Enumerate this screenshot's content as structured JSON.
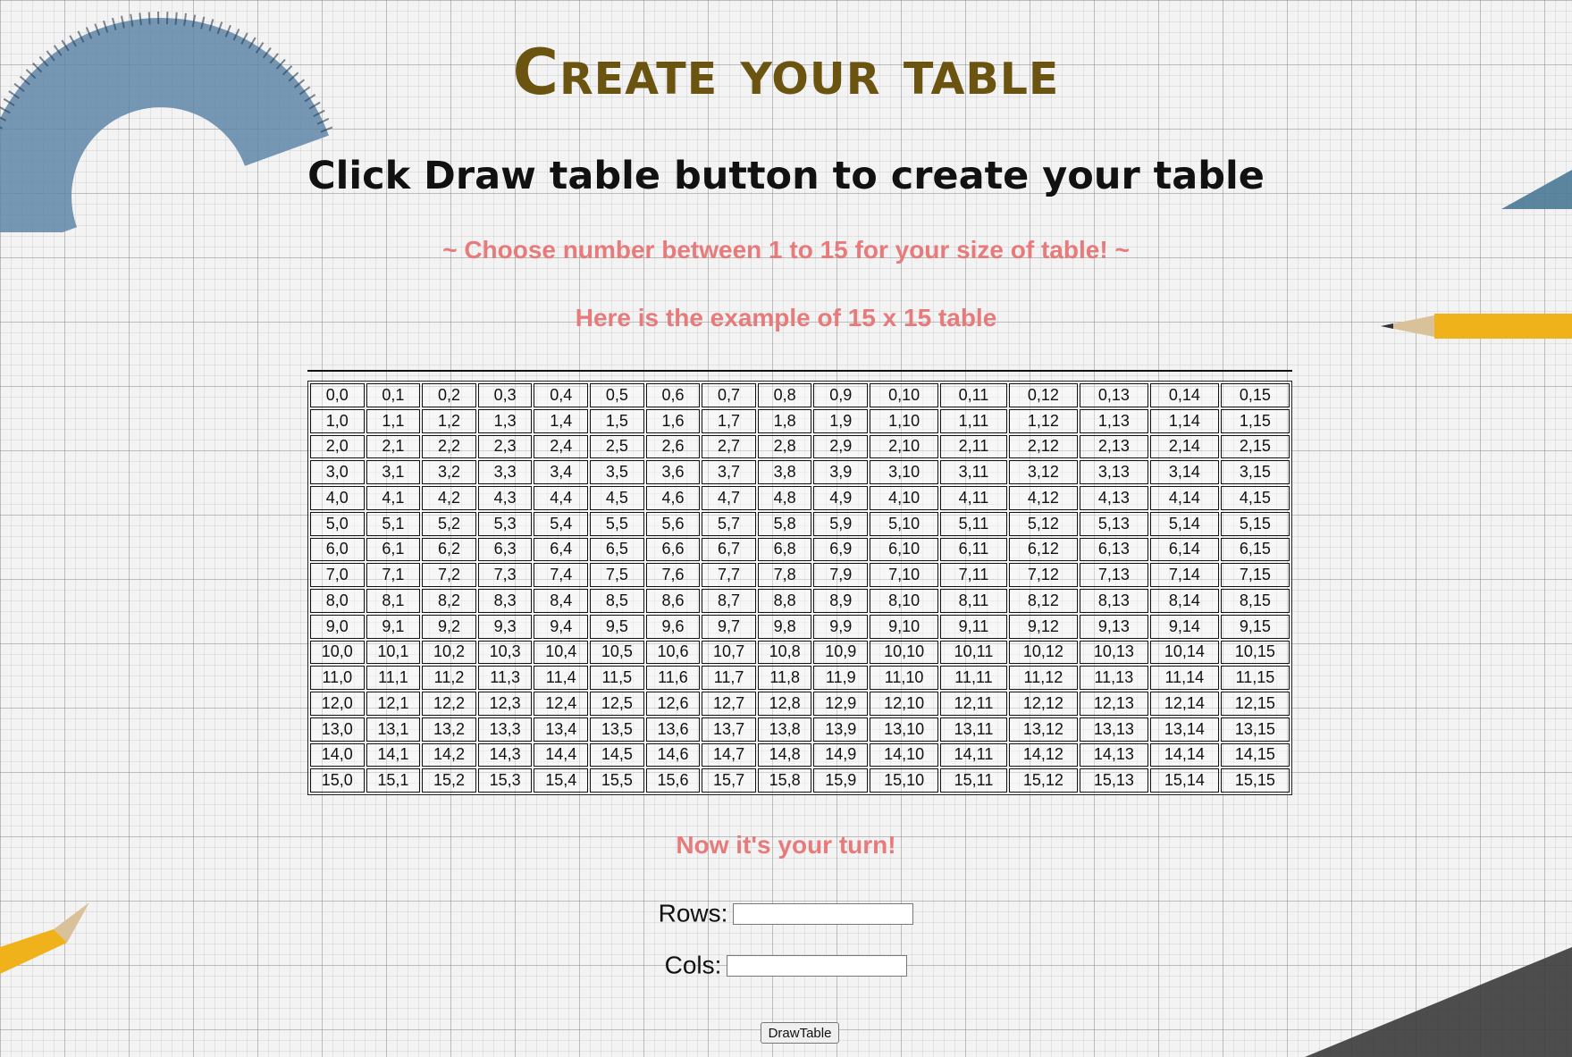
{
  "page": {
    "title": "Create your table",
    "subtitle": "Click Draw table button to create your table",
    "hint_range": "~ Choose number between 1 to 15 for your size of table! ~",
    "hint_example": "Here is the example of 15 x 15 table",
    "turn_text": "Now it's your turn!"
  },
  "example_table": {
    "rows": [
      [
        "0,0",
        "0,1",
        "0,2",
        "0,3",
        "0,4",
        "0,5",
        "0,6",
        "0,7",
        "0,8",
        "0,9",
        "0,10",
        "0,11",
        "0,12",
        "0,13",
        "0,14",
        "0,15"
      ],
      [
        "1,0",
        "1,1",
        "1,2",
        "1,3",
        "1,4",
        "1,5",
        "1,6",
        "1,7",
        "1,8",
        "1,9",
        "1,10",
        "1,11",
        "1,12",
        "1,13",
        "1,14",
        "1,15"
      ],
      [
        "2,0",
        "2,1",
        "2,2",
        "2,3",
        "2,4",
        "2,5",
        "2,6",
        "2,7",
        "2,8",
        "2,9",
        "2,10",
        "2,11",
        "2,12",
        "2,13",
        "2,14",
        "2,15"
      ],
      [
        "3,0",
        "3,1",
        "3,2",
        "3,3",
        "3,4",
        "3,5",
        "3,6",
        "3,7",
        "3,8",
        "3,9",
        "3,10",
        "3,11",
        "3,12",
        "3,13",
        "3,14",
        "3,15"
      ],
      [
        "4,0",
        "4,1",
        "4,2",
        "4,3",
        "4,4",
        "4,5",
        "4,6",
        "4,7",
        "4,8",
        "4,9",
        "4,10",
        "4,11",
        "4,12",
        "4,13",
        "4,14",
        "4,15"
      ],
      [
        "5,0",
        "5,1",
        "5,2",
        "5,3",
        "5,4",
        "5,5",
        "5,6",
        "5,7",
        "5,8",
        "5,9",
        "5,10",
        "5,11",
        "5,12",
        "5,13",
        "5,14",
        "5,15"
      ],
      [
        "6,0",
        "6,1",
        "6,2",
        "6,3",
        "6,4",
        "6,5",
        "6,6",
        "6,7",
        "6,8",
        "6,9",
        "6,10",
        "6,11",
        "6,12",
        "6,13",
        "6,14",
        "6,15"
      ],
      [
        "7,0",
        "7,1",
        "7,2",
        "7,3",
        "7,4",
        "7,5",
        "7,6",
        "7,7",
        "7,8",
        "7,9",
        "7,10",
        "7,11",
        "7,12",
        "7,13",
        "7,14",
        "7,15"
      ],
      [
        "8,0",
        "8,1",
        "8,2",
        "8,3",
        "8,4",
        "8,5",
        "8,6",
        "8,7",
        "8,8",
        "8,9",
        "8,10",
        "8,11",
        "8,12",
        "8,13",
        "8,14",
        "8,15"
      ],
      [
        "9,0",
        "9,1",
        "9,2",
        "9,3",
        "9,4",
        "9,5",
        "9,6",
        "9,7",
        "9,8",
        "9,9",
        "9,10",
        "9,11",
        "9,12",
        "9,13",
        "9,14",
        "9,15"
      ],
      [
        "10,0",
        "10,1",
        "10,2",
        "10,3",
        "10,4",
        "10,5",
        "10,6",
        "10,7",
        "10,8",
        "10,9",
        "10,10",
        "10,11",
        "10,12",
        "10,13",
        "10,14",
        "10,15"
      ],
      [
        "11,0",
        "11,1",
        "11,2",
        "11,3",
        "11,4",
        "11,5",
        "11,6",
        "11,7",
        "11,8",
        "11,9",
        "11,10",
        "11,11",
        "11,12",
        "11,13",
        "11,14",
        "11,15"
      ],
      [
        "12,0",
        "12,1",
        "12,2",
        "12,3",
        "12,4",
        "12,5",
        "12,6",
        "12,7",
        "12,8",
        "12,9",
        "12,10",
        "12,11",
        "12,12",
        "12,13",
        "12,14",
        "12,15"
      ],
      [
        "13,0",
        "13,1",
        "13,2",
        "13,3",
        "13,4",
        "13,5",
        "13,6",
        "13,7",
        "13,8",
        "13,9",
        "13,10",
        "13,11",
        "13,12",
        "13,13",
        "13,14",
        "13,15"
      ],
      [
        "14,0",
        "14,1",
        "14,2",
        "14,3",
        "14,4",
        "14,5",
        "14,6",
        "14,7",
        "14,8",
        "14,9",
        "14,10",
        "14,11",
        "14,12",
        "14,13",
        "14,14",
        "14,15"
      ],
      [
        "15,0",
        "15,1",
        "15,2",
        "15,3",
        "15,4",
        "15,5",
        "15,6",
        "15,7",
        "15,8",
        "15,9",
        "15,10",
        "15,11",
        "15,12",
        "15,13",
        "15,14",
        "15,15"
      ]
    ]
  },
  "form": {
    "rows_label": "Rows:",
    "rows_value": "",
    "cols_label": "Cols:",
    "cols_value": "",
    "button_label": "DrawTable"
  },
  "colors": {
    "title": "#6b5410",
    "hint": "#e77a7a",
    "background": "#f3f3f3"
  },
  "background_icons": [
    "protractor-icon",
    "pencil-icon",
    "ruler-icon",
    "set-square-icon"
  ]
}
